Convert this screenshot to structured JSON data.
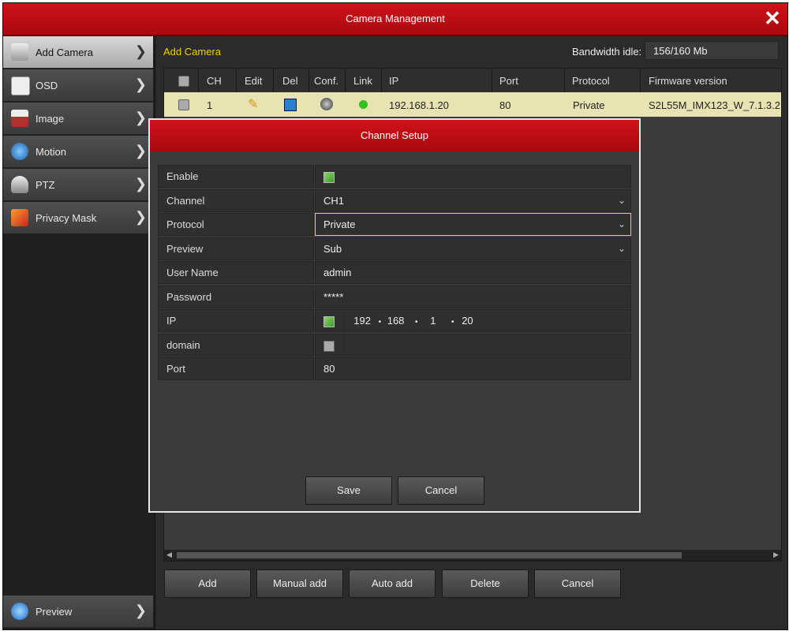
{
  "window": {
    "title": "Camera Management"
  },
  "sidebar": {
    "items": [
      {
        "label": "Add Camera",
        "icon": "camera-icon",
        "active": true
      },
      {
        "label": "OSD",
        "icon": "osd-icon"
      },
      {
        "label": "Image",
        "icon": "image-icon"
      },
      {
        "label": "Motion",
        "icon": "motion-icon"
      },
      {
        "label": "PTZ",
        "icon": "ptz-icon"
      },
      {
        "label": "Privacy Mask",
        "icon": "privacy-mask-icon"
      }
    ],
    "preview_label": "Preview"
  },
  "main": {
    "section_title": "Add Camera",
    "bandwidth_label": "Bandwidth idle:",
    "bandwidth_value": "156/160 Mb",
    "columns": [
      "CH",
      "Edit",
      "Del",
      "Conf.",
      "Link",
      "IP",
      "Port",
      "Protocol",
      "Firmware version"
    ],
    "rows": [
      {
        "ch": "1",
        "ip": "192.168.1.20",
        "port": "80",
        "protocol": "Private",
        "firmware": "S2L55M_IMX123_W_7.1.3.2",
        "link_color": "#33c21c"
      }
    ],
    "buttons": {
      "add": "Add",
      "manual_add": "Manual add",
      "auto_add": "Auto add",
      "delete": "Delete",
      "cancel": "Cancel"
    }
  },
  "dialog": {
    "title": "Channel Setup",
    "fields": {
      "enable": {
        "label": "Enable",
        "checked": true
      },
      "channel": {
        "label": "Channel",
        "value": "CH1"
      },
      "protocol": {
        "label": "Protocol",
        "value": "Private"
      },
      "preview": {
        "label": "Preview",
        "value": "Sub"
      },
      "username": {
        "label": "User Name",
        "value": "admin"
      },
      "password": {
        "label": "Password",
        "value": "*****"
      },
      "ip": {
        "label": "IP",
        "octets": [
          "192",
          "168",
          "1",
          "20"
        ],
        "checked": true
      },
      "domain": {
        "label": "domain",
        "value": "",
        "checked": false
      },
      "port": {
        "label": "Port",
        "value": "80"
      }
    },
    "buttons": {
      "save": "Save",
      "cancel": "Cancel"
    }
  }
}
